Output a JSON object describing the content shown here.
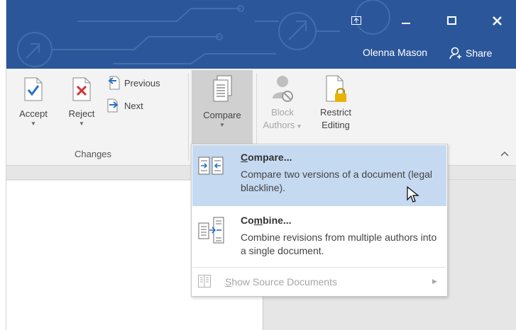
{
  "window": {
    "user_name": "Olenna Mason",
    "share_label": "Share",
    "accent_color": "#2b579a"
  },
  "ribbon": {
    "changes_group": {
      "label": "Changes",
      "accept_label": "Accept",
      "reject_label": "Reject",
      "previous_label": "Previous",
      "next_label": "Next"
    },
    "compare_label": "Compare",
    "block_authors_line1": "Block",
    "block_authors_line2": "Authors",
    "restrict_editing_line1": "Restrict",
    "restrict_editing_line2": "Editing"
  },
  "compare_menu": {
    "highlight_color": "#c5d9f1",
    "items": [
      {
        "title_prefix": "",
        "title_accel": "C",
        "title_rest": "ompare...",
        "description": "Compare two versions of a document (legal blackline).",
        "icon": "compare-versions-icon"
      },
      {
        "title_prefix": "Co",
        "title_accel": "m",
        "title_rest": "bine...",
        "description": "Combine revisions from multiple authors into a single document.",
        "icon": "combine-documents-icon"
      }
    ],
    "show_source": {
      "accel": "S",
      "rest": "how Source Documents",
      "icon": "source-documents-icon",
      "enabled": false
    }
  }
}
